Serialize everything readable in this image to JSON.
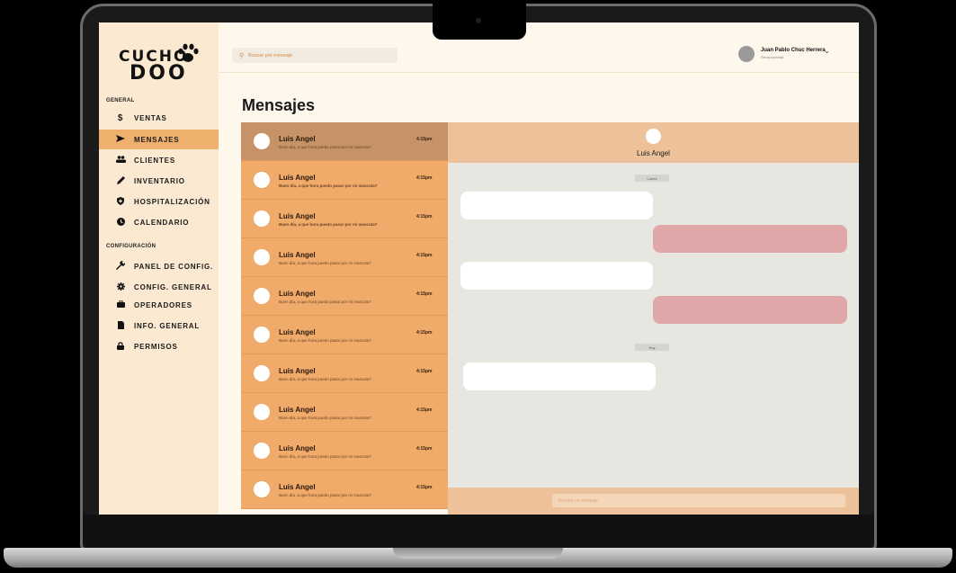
{
  "brand": {
    "line1": "CUCHO",
    "line2": "DOO"
  },
  "search": {
    "placeholder": "Buscar por mensaje"
  },
  "user": {
    "name": "Juan Pablo Chuc Herrera",
    "role": "Recepcionista"
  },
  "sidebar": {
    "section_general": "GENERAL",
    "section_config": "CONFIGURACIÓN",
    "general_items": [
      {
        "label": "VENTAS",
        "icon": "dollar-icon"
      },
      {
        "label": "MENSAJES",
        "icon": "send-icon"
      },
      {
        "label": "CLIENTES",
        "icon": "users-icon"
      },
      {
        "label": "INVENTARIO",
        "icon": "pencil-icon"
      },
      {
        "label": "HOSPITALIZACIÓN",
        "icon": "shield-icon"
      },
      {
        "label": "CALENDARIO",
        "icon": "clock-icon"
      }
    ],
    "config_items": [
      {
        "label": "PANEL DE CONFIG.",
        "icon": "wrench-icon"
      },
      {
        "label": "CONFIG. GENERAL",
        "icon": "gear-icon"
      },
      {
        "label": "OPERADORES",
        "icon": "briefcase-icon"
      },
      {
        "label": "INFO. GENERAL",
        "icon": "document-icon"
      },
      {
        "label": "PERMISOS",
        "icon": "lock-icon"
      }
    ],
    "active": "MENSAJES"
  },
  "page_title": "Mensajes",
  "conversations": [
    {
      "name": "Luis Angel",
      "preview": "Buen día, a que hora puedo pasar por mi mascota?",
      "time": "4:15pm"
    },
    {
      "name": "Luis Angel",
      "preview": "Buen día, a que hora puedo pasar por mi mascota?",
      "time": "4:15pm"
    },
    {
      "name": "Luis Angel",
      "preview": "Buen día, a que hora puedo pasar por mi mascota?",
      "time": "4:15pm"
    },
    {
      "name": "Luis Angel",
      "preview": "Buen día, a que hora puedo pasar por mi mascota?",
      "time": "4:15pm"
    },
    {
      "name": "Luis Angel",
      "preview": "Buen día, a que hora puedo pasar por mi mascota?",
      "time": "4:15pm"
    },
    {
      "name": "Luis Angel",
      "preview": "Buen día, a que hora puedo pasar por mi mascota?",
      "time": "4:15pm"
    },
    {
      "name": "Luis Angel",
      "preview": "Buen día, a que hora puedo pasar por mi mascota?",
      "time": "4:15pm"
    },
    {
      "name": "Luis Angel",
      "preview": "Buen día, a que hora puedo pasar por mi mascota?",
      "time": "4:15pm"
    },
    {
      "name": "Luis Angel",
      "preview": "Buen día, a que hora puedo pasar por mi mascota?",
      "time": "4:15pm"
    },
    {
      "name": "Luis Angel",
      "preview": "Buen día, a que hora puedo pasar por mi mascota?",
      "time": "4:15pm"
    }
  ],
  "chat": {
    "contact_name": "Luis Angel",
    "day_labels": [
      "Lunes",
      "Hoy"
    ],
    "compose_placeholder": "Escribe un mensaje"
  },
  "colors": {
    "sidebar_bg": "#fbe9d2",
    "accent": "#f0b06d",
    "conversation_bg": "#f0aa6a",
    "outgoing_bubble": "#dfa7a8"
  }
}
